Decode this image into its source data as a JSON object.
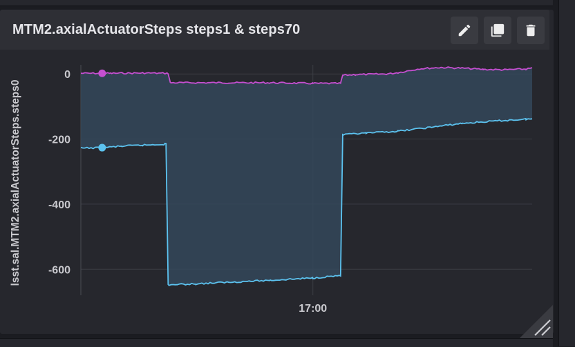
{
  "panel": {
    "title": "MTM2.axialActuatorSteps steps1 & steps70"
  },
  "toolbar": {
    "edit_icon": "pencil-icon",
    "duplicate_icon": "duplicate-icon",
    "delete_icon": "trash-icon"
  },
  "colors": {
    "background": "#1b1c21",
    "panel": "#26272d",
    "header": "#2e2f35",
    "grid": "#3c3e45",
    "area_fill": "#34485a",
    "series_steps1": "#5cc3f0",
    "series_steps70": "#c64fd1"
  },
  "chart_data": {
    "type": "line",
    "title": "",
    "xlabel": "",
    "ylabel": "lsst.sal.MTM2.axialActuatorSteps.steps0",
    "x_tick_labels": [
      "17:00"
    ],
    "y_tick_labels": [
      "0",
      "-200",
      "-400",
      "-600"
    ],
    "y_ticks": [
      0,
      -200,
      -400,
      -600
    ],
    "ylim": [
      -680,
      28
    ],
    "x_unit": "minutes",
    "xlim": [
      -10.9,
      10.3
    ],
    "x_ticks": [
      0
    ],
    "grid": true,
    "legend": "none",
    "series": [
      {
        "color": "#c64fd1",
        "marker_at_x": -9.9,
        "points": [
          [
            -10.9,
            2
          ],
          [
            -9.5,
            2
          ],
          [
            -8,
            3
          ],
          [
            -6.8,
            2
          ],
          [
            -6.7,
            -27
          ],
          [
            -4,
            -27
          ],
          [
            -2,
            -27
          ],
          [
            0,
            -29
          ],
          [
            1.3,
            -29
          ],
          [
            1.4,
            -4
          ],
          [
            2,
            -2
          ],
          [
            3.5,
            0
          ],
          [
            4,
            4
          ],
          [
            5,
            16
          ],
          [
            6,
            20
          ],
          [
            7,
            18
          ],
          [
            8,
            14
          ],
          [
            9,
            13
          ],
          [
            10,
            15
          ],
          [
            10.3,
            18
          ]
        ]
      },
      {
        "color": "#5cc3f0",
        "marker_at_x": -9.9,
        "points": [
          [
            -10.9,
            -228
          ],
          [
            -10,
            -227
          ],
          [
            -9,
            -222
          ],
          [
            -8,
            -219
          ],
          [
            -7,
            -216
          ],
          [
            -6.9,
            -214
          ],
          [
            -6.8,
            -648
          ],
          [
            -5.5,
            -645
          ],
          [
            -4,
            -640
          ],
          [
            -2,
            -634
          ],
          [
            0,
            -627
          ],
          [
            1.3,
            -619
          ],
          [
            1.4,
            -187
          ],
          [
            2.5,
            -182
          ],
          [
            4,
            -176
          ],
          [
            5.5,
            -164
          ],
          [
            7,
            -152
          ],
          [
            8.5,
            -145
          ],
          [
            10,
            -139
          ],
          [
            10.3,
            -138
          ]
        ]
      }
    ]
  }
}
